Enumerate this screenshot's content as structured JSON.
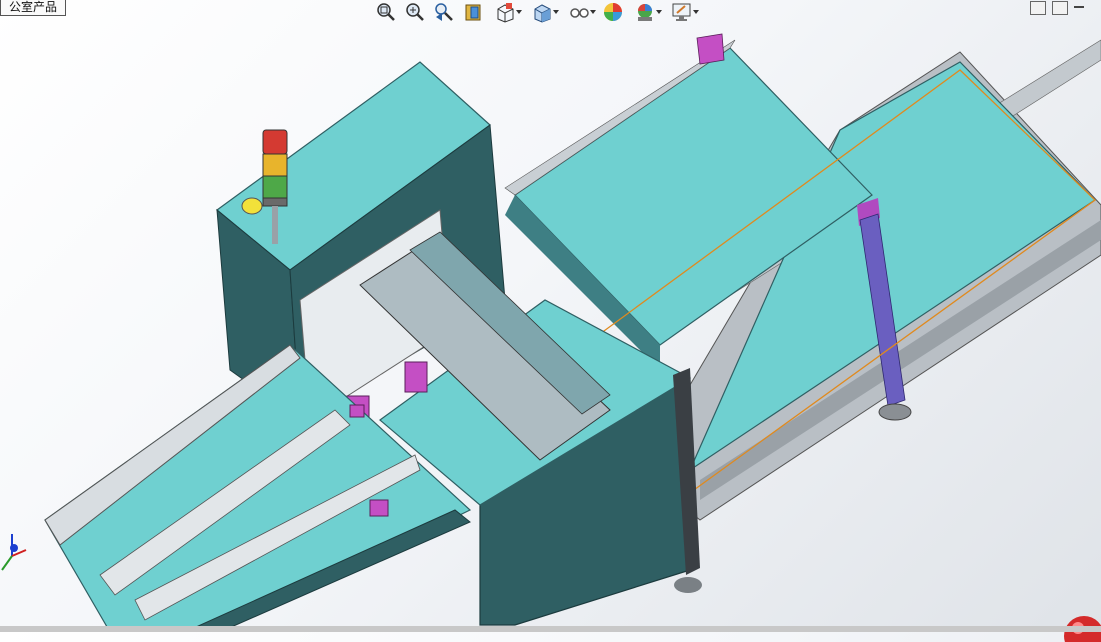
{
  "document_tab": {
    "label": "公室产品"
  },
  "heads_up_toolbar": {
    "items": [
      {
        "name": "zoom-to-fit-icon",
        "dropdown": false
      },
      {
        "name": "zoom-to-area-icon",
        "dropdown": false
      },
      {
        "name": "previous-view-icon",
        "dropdown": false
      },
      {
        "name": "section-view-icon",
        "dropdown": false
      },
      {
        "name": "view-orientation-icon",
        "dropdown": true
      },
      {
        "name": "display-style-icon",
        "dropdown": true
      },
      {
        "name": "hide-show-items-icon",
        "dropdown": true
      },
      {
        "name": "edit-appearance-icon",
        "dropdown": false
      },
      {
        "name": "apply-scene-icon",
        "dropdown": true
      },
      {
        "name": "view-settings-icon",
        "dropdown": true
      }
    ]
  },
  "colors": {
    "panel_cyan": "#6fd0d0",
    "frame_dark": "#2f5f63",
    "rail_silver": "#c9cfd4",
    "accent_magenta": "#c44fc4",
    "leg_purple": "#6a5fc0",
    "selection_orange": "#e08a1e",
    "background": "#f4f6f9"
  }
}
